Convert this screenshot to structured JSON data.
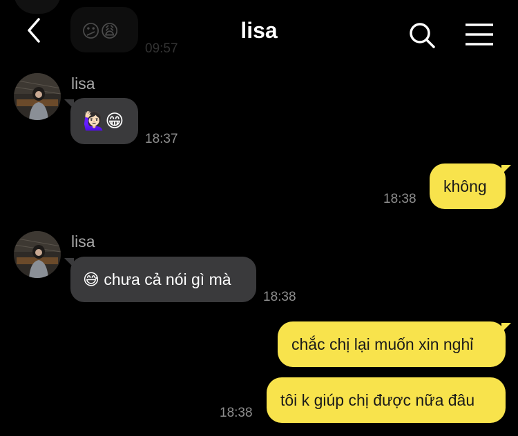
{
  "header": {
    "title": "lisa",
    "back_icon": "chevron-left-icon",
    "search_icon": "search-icon",
    "menu_icon": "hamburger-menu-icon"
  },
  "previous_message": {
    "emoji": "😕😩",
    "time": "09:57"
  },
  "messages": [
    {
      "direction": "in",
      "sender": "lisa",
      "text": "🙋🏻‍♀️😁",
      "time": "18:37"
    },
    {
      "direction": "out",
      "text": "không",
      "time": "18:38"
    },
    {
      "direction": "in",
      "sender": "lisa",
      "text": "😅 chưa cả nói gì mà",
      "time": "18:38"
    },
    {
      "direction": "out",
      "text": "chắc chị lại muốn xin nghỉ"
    },
    {
      "direction": "out",
      "text": "tôi k giúp chị được nữa đâu",
      "time": "18:38"
    }
  ],
  "colors": {
    "background": "#000000",
    "incoming_bubble": "#3a3a3c",
    "outgoing_bubble": "#f8e34c",
    "timestamp": "#8e8e8e"
  }
}
